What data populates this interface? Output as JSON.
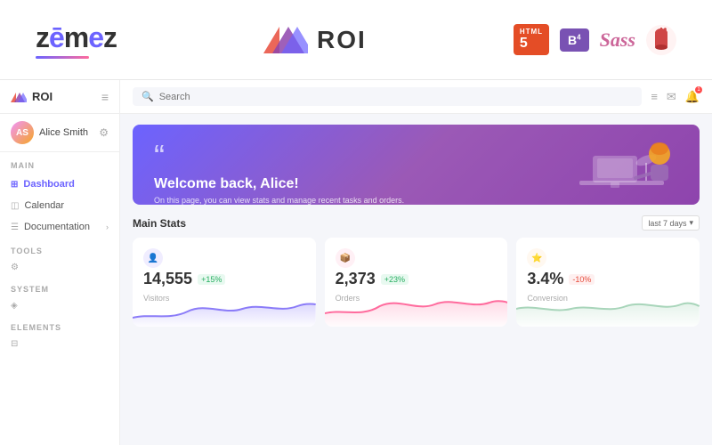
{
  "topBanner": {
    "zemesLogo": "zēmez",
    "roiLabel": "ROI",
    "techStack": [
      "HTML5",
      "B4",
      "Sass",
      "Gulp"
    ]
  },
  "sidebar": {
    "logoText": "ROI",
    "userName": "Alice Smith",
    "sections": {
      "main": "MAIN",
      "tools": "TooLs",
      "system": "SYSTEM",
      "elements": "ELEMENTS"
    },
    "navItems": {
      "dashboard": "Dashboard",
      "calendar": "Calendar",
      "documentation": "Documentation"
    }
  },
  "topbar": {
    "searchPlaceholder": "Search"
  },
  "welcomeBanner": {
    "quoteChar": "“",
    "title": "Welcome back, Alice!",
    "subtitle": "On this page, you can view stats and manage recent tasks and orders."
  },
  "stats": {
    "sectionTitle": "Main Stats",
    "filterLabel": "last 7 days",
    "cards": [
      {
        "value": "14,555",
        "change": "+15%",
        "changeType": "up",
        "label": "Visitors",
        "iconType": "purple"
      },
      {
        "value": "2,373",
        "change": "+23%",
        "changeType": "up",
        "label": "Orders",
        "iconType": "pink"
      },
      {
        "value": "3.4%",
        "change": "-10%",
        "changeType": "down",
        "label": "Conversion",
        "iconType": "orange"
      }
    ]
  }
}
